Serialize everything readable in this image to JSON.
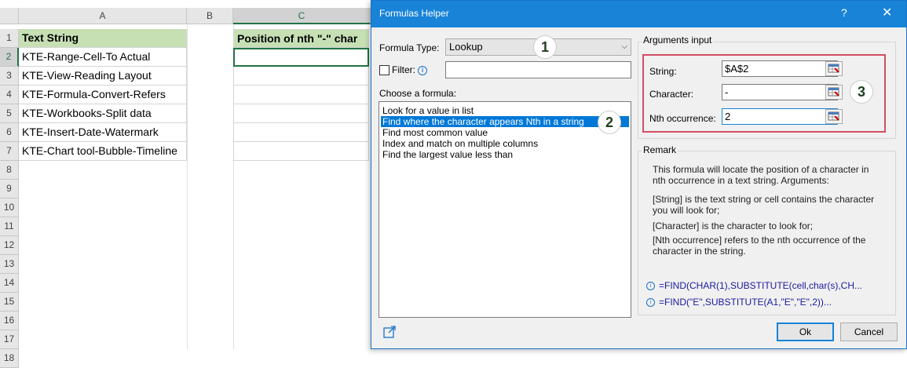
{
  "sheet": {
    "columns": [
      "A",
      "B",
      "C"
    ],
    "rows": [
      "1",
      "2",
      "3",
      "4",
      "5",
      "6",
      "7",
      "8",
      "9",
      "10",
      "11",
      "12",
      "13",
      "14",
      "15",
      "16",
      "17",
      "18"
    ],
    "header_a": "Text String",
    "header_c": "Position of nth \"-\" char",
    "values": [
      "KTE-Range-Cell-To Actual",
      "KTE-View-Reading Layout",
      "KTE-Formula-Convert-Refers",
      "KTE-Workbooks-Split data",
      "KTE-Insert-Date-Watermark",
      "KTE-Chart tool-Bubble-Timeline"
    ],
    "header_fill": "#c6e0b4"
  },
  "dialog": {
    "title": "Formulas Helper",
    "help": "?",
    "close": "✕",
    "formula_type_label": "Formula Type:",
    "formula_type_value": "Lookup",
    "filter_label": "Filter:",
    "filter_value": "",
    "choose_label": "Choose a formula:",
    "formulas": [
      "Look for a value in list",
      "Find where the character appears Nth in a string",
      "Find most common value",
      "Index and match on multiple columns",
      "Find the largest value less than"
    ],
    "selected_index": 1,
    "arguments_label": "Arguments input",
    "args": [
      {
        "label": "String:",
        "value": "$A$2"
      },
      {
        "label": "Character:",
        "value": "-"
      },
      {
        "label": "Nth occurrence:",
        "value": "2"
      }
    ],
    "remark_label": "Remark",
    "remark_lines": [
      "This formula will locate the position of a character in nth occurrence in a text string. Arguments:",
      "[String] is the text string or cell contains the character you will look for;",
      "[Character] is the character to look for;",
      "[Nth occurrence] refers to the nth occurrence of the character in the string."
    ],
    "formula_examples": [
      "=FIND(CHAR(1),SUBSTITUTE(cell,char(s),CH...",
      "=FIND(\"E\",SUBSTITUTE(A1,\"E\",\"E\",2))..."
    ],
    "ok": "Ok",
    "cancel": "Cancel",
    "badges": [
      "1",
      "2",
      "3"
    ],
    "accent": "#1883d7",
    "highlight": "#d24e63"
  }
}
